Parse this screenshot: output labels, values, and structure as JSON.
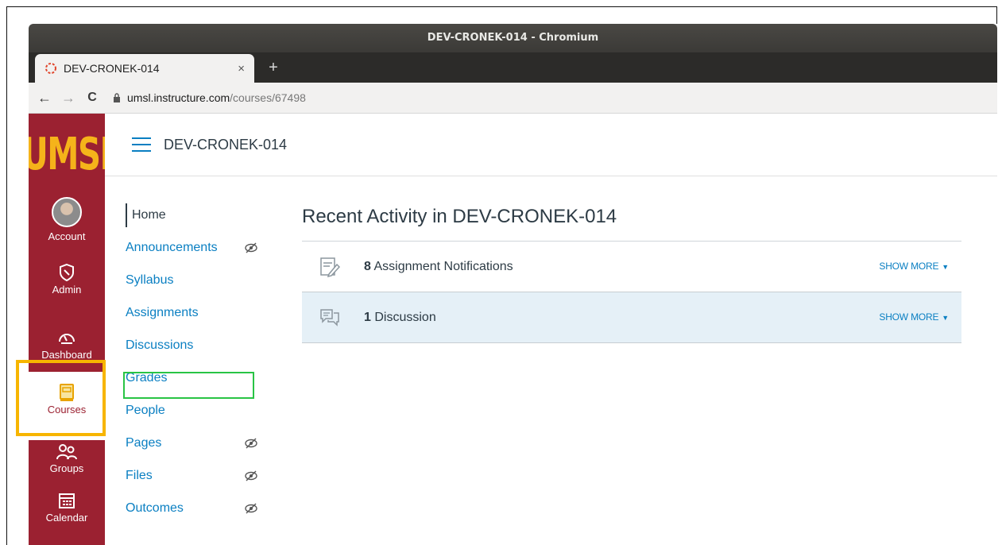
{
  "window": {
    "title": "DEV-CRONEK-014 - Chromium"
  },
  "tab": {
    "title": "DEV-CRONEK-014",
    "close": "×",
    "new_tab": "+"
  },
  "address": {
    "host": "umsl.instructure.com",
    "path": "/courses/67498"
  },
  "logo": {
    "text": "UMSL"
  },
  "global_nav": [
    {
      "label": "Account",
      "icon": "avatar"
    },
    {
      "label": "Admin",
      "icon": "shield-icon"
    },
    {
      "label": "Dashboard",
      "icon": "dashboard-icon"
    },
    {
      "label": "Courses",
      "icon": "book-icon"
    },
    {
      "label": "Groups",
      "icon": "groups-icon"
    },
    {
      "label": "Calendar",
      "icon": "calendar-icon"
    }
  ],
  "header": {
    "breadcrumb": "DEV-CRONEK-014"
  },
  "course_nav": [
    {
      "label": "Home",
      "active": true,
      "hidden": false
    },
    {
      "label": "Announcements",
      "hidden": true
    },
    {
      "label": "Syllabus",
      "hidden": false
    },
    {
      "label": "Assignments",
      "hidden": false
    },
    {
      "label": "Discussions",
      "hidden": false
    },
    {
      "label": "Grades",
      "hidden": false
    },
    {
      "label": "People",
      "hidden": false
    },
    {
      "label": "Pages",
      "hidden": true
    },
    {
      "label": "Files",
      "hidden": true
    },
    {
      "label": "Outcomes",
      "hidden": true
    }
  ],
  "main": {
    "title": "Recent Activity in DEV-CRONEK-014",
    "activity": [
      {
        "count": "8",
        "label": " Assignment Notifications",
        "more": "SHOW MORE"
      },
      {
        "count": "1",
        "label": " Discussion",
        "more": "SHOW MORE"
      }
    ]
  },
  "colors": {
    "brand": "#9b2131",
    "logo": "#f5b31a",
    "link": "#0a7fc2",
    "highlight_orange": "#f7b500",
    "highlight_green": "#29c445"
  }
}
